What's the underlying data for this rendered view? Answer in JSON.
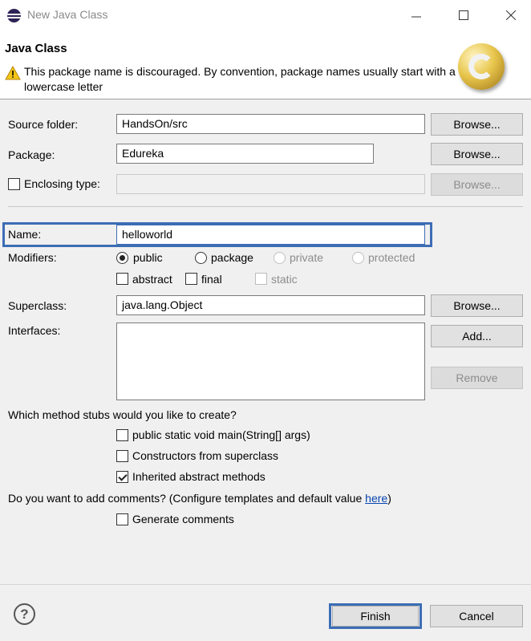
{
  "window": {
    "title": "New Java Class",
    "minimize_icon": "minimize-icon",
    "maximize_icon": "maximize-icon",
    "close_icon": "close-icon"
  },
  "header": {
    "title": "Java Class",
    "warning_message": "This package name is discouraged. By convention, package names usually start with a lowercase letter",
    "warning_icon": "warning-icon",
    "logo_icon": "java-class-logo"
  },
  "form": {
    "source_folder": {
      "label": "Source folder:",
      "value": "HandsOn/src",
      "browse": "Browse..."
    },
    "package": {
      "label": "Package:",
      "value": "Edureka",
      "browse": "Browse..."
    },
    "enclosing_type": {
      "label": "Enclosing type:",
      "value": "",
      "browse": "Browse...",
      "checked": false
    },
    "name": {
      "label": "Name:",
      "value": "helloworld"
    },
    "modifiers": {
      "label": "Modifiers:",
      "access": [
        {
          "label": "public",
          "checked": true,
          "enabled": true
        },
        {
          "label": "package",
          "checked": false,
          "enabled": true
        },
        {
          "label": "private",
          "checked": false,
          "enabled": false
        },
        {
          "label": "protected",
          "checked": false,
          "enabled": false
        }
      ],
      "flags": [
        {
          "label": "abstract",
          "checked": false,
          "enabled": true
        },
        {
          "label": "final",
          "checked": false,
          "enabled": true
        },
        {
          "label": "static",
          "checked": false,
          "enabled": false
        }
      ]
    },
    "superclass": {
      "label": "Superclass:",
      "value": "java.lang.Object",
      "browse": "Browse..."
    },
    "interfaces": {
      "label": "Interfaces:",
      "add": "Add...",
      "remove": "Remove"
    }
  },
  "stubs": {
    "question": "Which method stubs would you like to create?",
    "options": [
      {
        "label": "public static void main(String[] args)",
        "checked": false
      },
      {
        "label": "Constructors from superclass",
        "checked": false
      },
      {
        "label": "Inherited abstract methods",
        "checked": true
      }
    ]
  },
  "comments": {
    "question": "Do you want to add comments? (Configure templates and default value ",
    "link": "here",
    "suffix": ")",
    "option": {
      "label": "Generate comments",
      "checked": false
    }
  },
  "footer": {
    "help_icon": "help-icon",
    "help_glyph": "?",
    "finish": "Finish",
    "cancel": "Cancel"
  },
  "colors": {
    "highlight": "#3c6db5",
    "link": "#0645ad"
  }
}
